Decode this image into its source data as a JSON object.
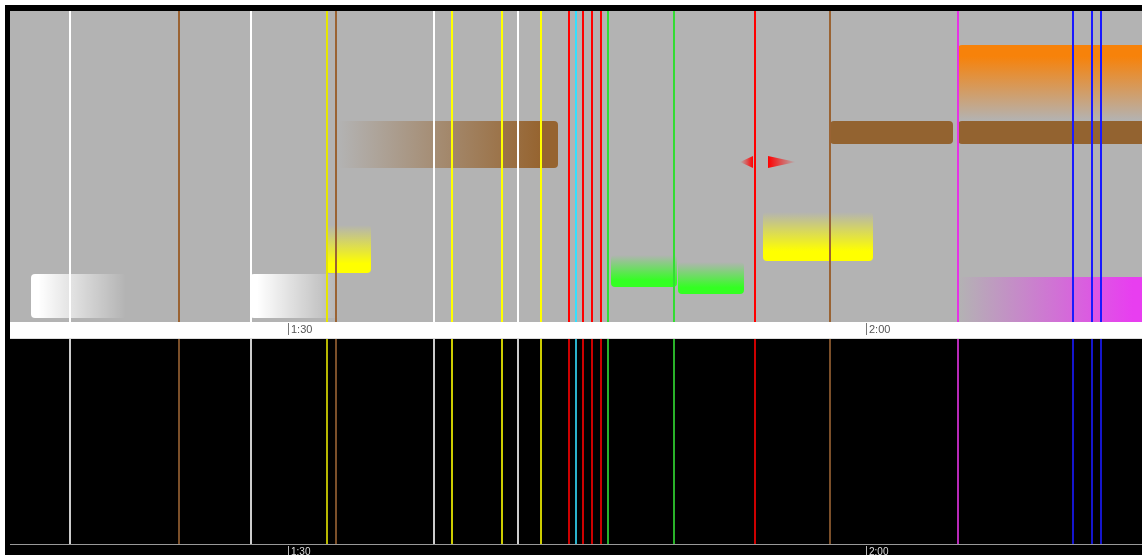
{
  "markers": [
    {
      "color": "#ffffff"
    },
    {
      "color": "#9a6333"
    },
    {
      "color": "#ffffff"
    },
    {
      "color": "#e6e600"
    },
    {
      "color": "#9a6333"
    },
    {
      "color": "#ffffff"
    },
    {
      "color": "#ffff00"
    },
    {
      "color": "#ffff00"
    },
    {
      "color": "#ffffff"
    },
    {
      "color": "#ffff00"
    },
    {
      "color": "#ff0000"
    },
    {
      "color": "#33e0ff"
    },
    {
      "color": "#ff0000"
    },
    {
      "color": "#ff0000"
    },
    {
      "color": "#ff0000"
    },
    {
      "color": "#33dd33"
    },
    {
      "color": "#33dd33"
    },
    {
      "color": "#ff0000"
    },
    {
      "color": "#9a6333"
    },
    {
      "color": "#e633e6"
    },
    {
      "color": "#1a1aff"
    },
    {
      "color": "#1a1aff"
    },
    {
      "color": "#1a1aff"
    }
  ],
  "blocks": [
    {
      "kind": "ramp-right-out",
      "color": "#ffffff"
    },
    {
      "kind": "ramp-right-out",
      "color": "#ffffff"
    },
    {
      "kind": "ramp-down",
      "color": "#ffff00"
    },
    {
      "kind": "ramp-right-in",
      "color": "#966430"
    },
    {
      "kind": "ramp-down",
      "color": "#33ff22"
    },
    {
      "kind": "ramp-down",
      "color": "#33ff22"
    },
    {
      "kind": "ramp-down",
      "color": "#ffff00"
    },
    {
      "kind": "solid",
      "color": "#936330"
    },
    {
      "kind": "solid",
      "color": "#936330"
    },
    {
      "kind": "ramp-up",
      "color": "#f7820a"
    },
    {
      "kind": "ramp-right-in",
      "color": "#e83ef0"
    }
  ],
  "top_ruler": {
    "labels": [
      "1:30",
      "2:00"
    ]
  },
  "bottom_ruler": {
    "labels": [
      "1:30",
      "2:00"
    ]
  }
}
